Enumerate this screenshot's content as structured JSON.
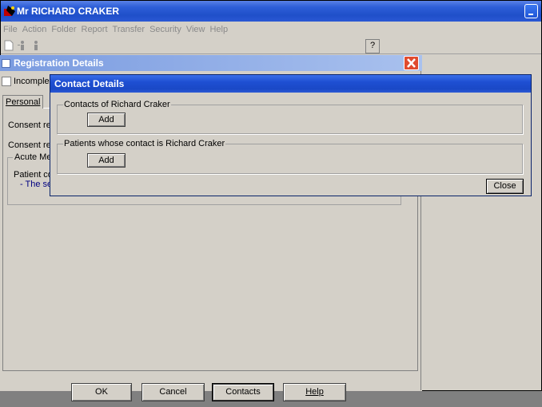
{
  "app": {
    "title": "Mr RICHARD CRAKER",
    "menu": [
      "File",
      "Action",
      "Folder",
      "Report",
      "Transfer",
      "Security",
      "View",
      "Help"
    ],
    "help_tool_glyph": "?"
  },
  "registration": {
    "title": "Registration Details",
    "incomplete_label": "Incomple",
    "tab_personal": "Personal",
    "consent_label_1": "Consent re",
    "consent_label_2": "Consent re",
    "acute_legend": "Acute Me",
    "patient_note_label": "Patient co",
    "patient_note_detail": "- The se",
    "buttons": {
      "ok": "OK",
      "cancel": "Cancel",
      "contacts": "Contacts",
      "help": "Help"
    }
  },
  "contact_dialog": {
    "title": "Contact Details",
    "contacts_of_legend": "Contacts of Richard Craker",
    "contacts_of_add": "Add",
    "patients_legend": "Patients whose contact is Richard Craker",
    "patients_add": "Add",
    "close": "Close"
  },
  "icons": [
    "app-logo-icon",
    "minimize-icon",
    "new-document-icon",
    "add-person-icon",
    "person-icon",
    "help-pointer-icon",
    "checkbox-icon",
    "close-icon"
  ],
  "colors": {
    "titlebar_active": "#1f4fc9",
    "titlebar_inactive": "#7a9be0",
    "close_red": "#e04b2f",
    "face": "#d4d0c8",
    "desktop": "#808080"
  }
}
